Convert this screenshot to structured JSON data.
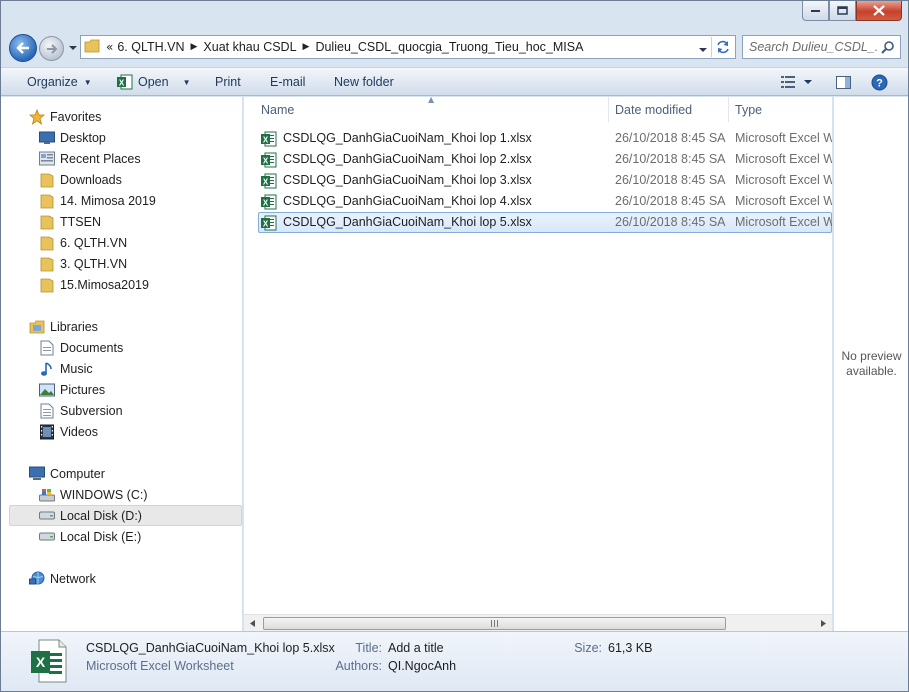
{
  "address": {
    "overflow": "«",
    "crumbs": [
      "6. QLTH.VN",
      "Xuat khau CSDL",
      "Dulieu_CSDL_quocgia_Truong_Tieu_hoc_MISA"
    ],
    "search_placeholder": "Search Dulieu_CSDL_..."
  },
  "toolbar": {
    "organize": "Organize",
    "open": "Open",
    "print": "Print",
    "email": "E-mail",
    "new_folder": "New folder"
  },
  "nav": {
    "favorites_label": "Favorites",
    "favorites": [
      "Desktop",
      "Recent Places",
      "Downloads",
      "14. Mimosa 2019",
      "TTSEN",
      "6. QLTH.VN",
      "3. QLTH.VN",
      "15.Mimosa2019"
    ],
    "libraries_label": "Libraries",
    "libraries": [
      "Documents",
      "Music",
      "Pictures",
      "Subversion",
      "Videos"
    ],
    "computer_label": "Computer",
    "drives": [
      "WINDOWS (C:)",
      "Local Disk (D:)",
      "Local Disk (E:)"
    ],
    "network_label": "Network"
  },
  "columns": {
    "name": "Name",
    "date": "Date modified",
    "type": "Type"
  },
  "files": [
    {
      "name": "CSDLQG_DanhGiaCuoiNam_Khoi lop 1.xlsx",
      "date": "26/10/2018 8:45 SA",
      "type": "Microsoft Excel W..."
    },
    {
      "name": "CSDLQG_DanhGiaCuoiNam_Khoi lop 2.xlsx",
      "date": "26/10/2018 8:45 SA",
      "type": "Microsoft Excel W..."
    },
    {
      "name": "CSDLQG_DanhGiaCuoiNam_Khoi lop 3.xlsx",
      "date": "26/10/2018 8:45 SA",
      "type": "Microsoft Excel W..."
    },
    {
      "name": "CSDLQG_DanhGiaCuoiNam_Khoi lop 4.xlsx",
      "date": "26/10/2018 8:45 SA",
      "type": "Microsoft Excel W..."
    },
    {
      "name": "CSDLQG_DanhGiaCuoiNam_Khoi lop 5.xlsx",
      "date": "26/10/2018 8:45 SA",
      "type": "Microsoft Excel W..."
    }
  ],
  "preview": {
    "line1": "No preview",
    "line2": "available."
  },
  "details": {
    "name": "CSDLQG_DanhGiaCuoiNam_Khoi lop 5.xlsx",
    "kind": "Microsoft Excel Worksheet",
    "title_label": "Title:",
    "title_value": "Add a title",
    "authors_label": "Authors:",
    "authors_value": "QI.NgocAnh",
    "size_label": "Size:",
    "size_value": "61,3 KB"
  },
  "colors": {
    "excel_green": "#1e7145",
    "folder_yellow": "#e8c25a",
    "selection": "#d6e8fb",
    "toolbar_text": "#1e395b"
  }
}
